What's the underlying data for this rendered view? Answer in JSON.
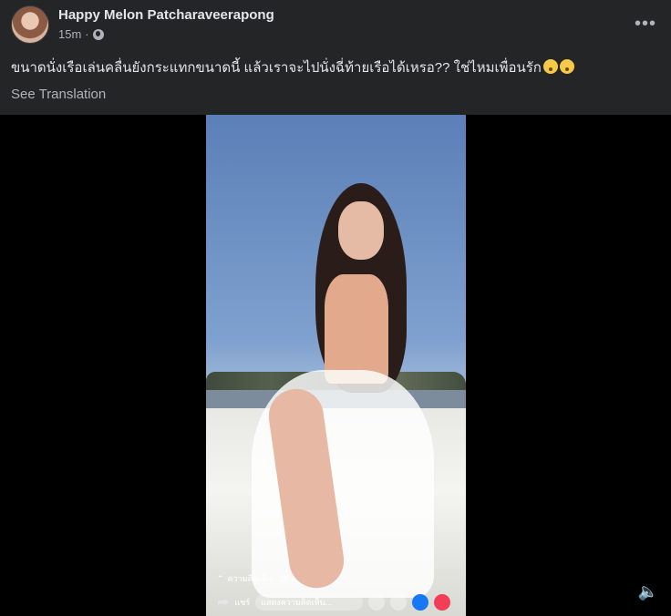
{
  "post": {
    "author": "Happy Melon Patcharaveerapong",
    "time": "15m",
    "more_label": "•••",
    "caption": "ขนาดนั่งเรือเล่นคลื่นยังกระแทกขนาดนี้  แล้วเราจะไปนั่งฉี่ท้ายเรือได้เหรอ??   ใช่ไหมเพื่อนรัก",
    "translate_label": "See Translation"
  },
  "video": {
    "comments_label": "ความคิดเห็น · 28 ·",
    "share_label": "แชร์",
    "comment_placeholder": "แสดงความคิดเห็น...",
    "mute_icon": "🔈"
  },
  "icons": [
    "globe-icon",
    "more-icon",
    "chevron-up-icon",
    "share-icon",
    "like-icon",
    "love-icon",
    "mute-icon"
  ]
}
